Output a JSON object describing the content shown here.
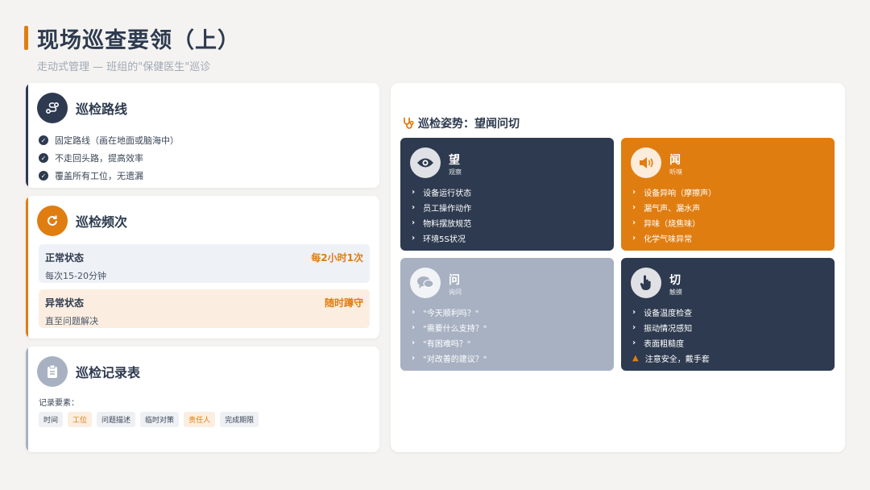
{
  "header": {
    "title": "现场巡查要领（上）",
    "subtitle": "走动式管理 — 班组的\"保健医生\"巡诊"
  },
  "route": {
    "title": "巡检路线",
    "items": [
      "固定路线（画在地面或脑海中）",
      "不走回头路，提高效率",
      "覆盖所有工位，无遗漏"
    ]
  },
  "frequency": {
    "title": "巡检频次",
    "normal": {
      "name": "正常状态",
      "value": "每2小时1次",
      "desc": "每次15-20分钟"
    },
    "abnormal": {
      "name": "异常状态",
      "value": "随时蹲守",
      "desc": "直至问题解决"
    }
  },
  "record": {
    "title": "巡检记录表",
    "label": "记录要素：",
    "tags": [
      "时间",
      "工位",
      "问题描述",
      "临时对策",
      "责任人",
      "完成期限"
    ]
  },
  "posture": {
    "title": "巡检姿势：望闻问切",
    "tiles": [
      {
        "name": "望",
        "sub": "观察",
        "icon": "eye-icon",
        "items": [
          "设备运行状态",
          "员工操作动作",
          "物料摆放规范",
          "环境5S状况"
        ]
      },
      {
        "name": "闻",
        "sub": "听嗅",
        "icon": "speaker-icon",
        "items": [
          "设备异响（摩擦声）",
          "漏气声、漏水声",
          "异味（烧焦味）",
          "化学气味异常"
        ]
      },
      {
        "name": "问",
        "sub": "询问",
        "icon": "chat-icon",
        "items": [
          "\"今天顺利吗？\"",
          "\"需要什么支持？\"",
          "\"有困难吗？\"",
          "\"对改善的建议？\""
        ]
      },
      {
        "name": "切",
        "sub": "触摸",
        "icon": "hand-pointer-icon",
        "items": [
          "设备温度检查",
          "振动情况感知",
          "表面粗糙度",
          "注意安全，戴手套"
        ]
      }
    ]
  },
  "colors": {
    "navy": "#2d3a4f",
    "orange": "#e07d10",
    "gray": "#a7b1c2"
  }
}
